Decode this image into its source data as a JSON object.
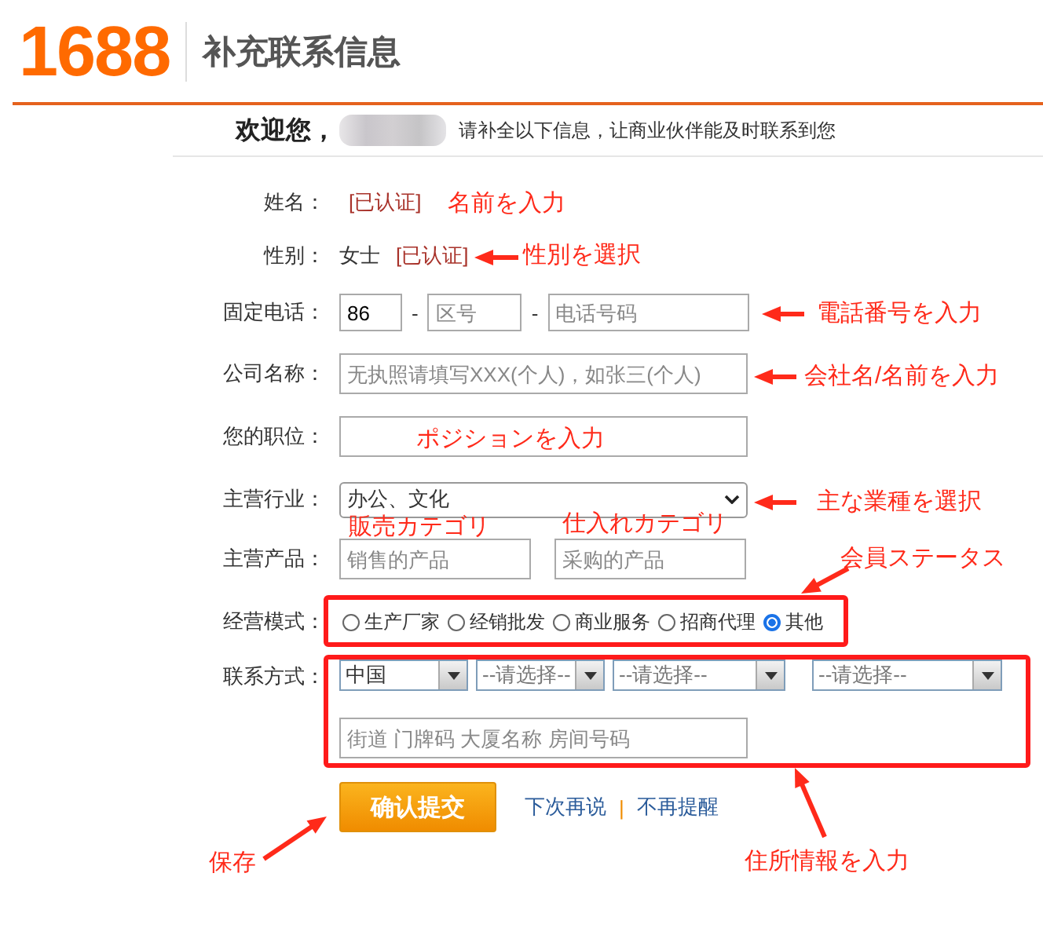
{
  "header": {
    "logo": "1688",
    "title": "补充联系信息"
  },
  "welcome": {
    "greeting": "欢迎您，",
    "message": "请补全以下信息，让商业伙伴能及时联系到您"
  },
  "fields": [
    {
      "kind": "verified",
      "label": "姓名：",
      "badge": "[已认证]"
    },
    {
      "kind": "verified",
      "label": "性别：",
      "value": "女士",
      "badge": "[已认证]"
    },
    {
      "kind": "phone",
      "label": "固定电话：",
      "inputs": [
        {
          "value": "86"
        },
        {
          "placeholder": "区号"
        },
        {
          "placeholder": "电话号码"
        }
      ],
      "separators": [
        "-",
        "-"
      ]
    },
    {
      "kind": "text",
      "label": "公司名称：",
      "placeholder": "无执照请填写XXX(个人)，如张三(个人)"
    },
    {
      "kind": "text",
      "label": "您的职位："
    },
    {
      "kind": "select",
      "label": "主营行业：",
      "value": "办公、文化"
    },
    {
      "kind": "pair",
      "label": "主营产品：",
      "inputs": [
        {
          "placeholder": "销售的产品"
        },
        {
          "placeholder": "采购的产品"
        }
      ]
    },
    {
      "kind": "radio",
      "label": "经营模式：",
      "options": [
        {
          "label": "生产厂家",
          "selected": false
        },
        {
          "label": "经销批发",
          "selected": false
        },
        {
          "label": "商业服务",
          "selected": false
        },
        {
          "label": "招商代理",
          "selected": false
        },
        {
          "label": "其他",
          "selected": true
        }
      ]
    },
    {
      "kind": "address",
      "label": "联系方式：",
      "selects": [
        "中国",
        "--请选择--",
        "--请选择--",
        "--请选择--"
      ],
      "placeholder": "街道 门牌码 大厦名称 房间号码"
    }
  ],
  "actions": {
    "submit": "确认提交",
    "links": [
      "下次再说",
      "不再提醒"
    ],
    "separator": "|"
  },
  "annotations": [
    "名前を入力",
    "性別を選択",
    "電話番号を入力",
    "会社名/名前を入力",
    "ポジションを入力",
    "主な業種を選択",
    "販売カテゴリ",
    "仕入れカテゴリ",
    "会員ステータス",
    "保存",
    "住所情報を入力"
  ]
}
